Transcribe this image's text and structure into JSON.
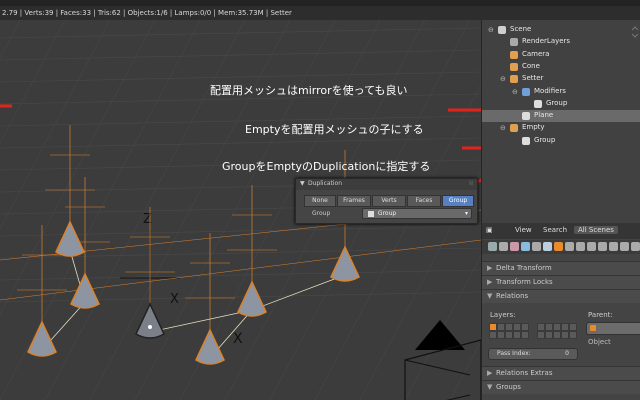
{
  "status": {
    "text": "2.79 | Verts:39 | Faces:33 | Tris:62 | Objects:1/6 | Lamps:0/0 | Mem:35.73M | Setter"
  },
  "outliner": {
    "items": [
      {
        "label": "Scene",
        "icon": "scene-icon",
        "color": "#cfcfcf"
      },
      {
        "label": "RenderLayers",
        "icon": "render-layers-icon",
        "color": "#a9a9a9"
      },
      {
        "label": "Camera",
        "icon": "camera-icon",
        "color": "#e0a050"
      },
      {
        "label": "Cone",
        "icon": "cone-icon",
        "color": "#e0a050"
      },
      {
        "label": "Setter",
        "icon": "object-icon",
        "color": "#e0a050"
      },
      {
        "label": "Modifiers",
        "icon": "wrench-icon",
        "color": "#6fa0d8"
      },
      {
        "label": "Group",
        "icon": "group-icon",
        "color": "#dddddd"
      },
      {
        "label": "Plane",
        "icon": "mesh-icon",
        "color": "#dddddd"
      },
      {
        "label": "Empty",
        "icon": "empty-icon",
        "color": "#e0a050"
      },
      {
        "label": "Group",
        "icon": "group-icon",
        "color": "#dddddd"
      }
    ]
  },
  "annotations": [
    {
      "text": "配置用メッシュはmirrorを使っても良い"
    },
    {
      "text": "Emptyを配置用メッシュの子にする"
    },
    {
      "text": "GroupをEmptyのDuplicationに指定する"
    }
  ],
  "duplication": {
    "title": "Duplication",
    "buttons": [
      "None",
      "Frames",
      "Verts",
      "Faces",
      "Group"
    ],
    "active": "Group",
    "group_label": "Group",
    "group_value": "Group"
  },
  "properties": {
    "tabs": [
      "View",
      "Search",
      "All Scenes"
    ],
    "panels": [
      "Delta Transform",
      "Transform Locks",
      "Relations",
      "Relations Extras",
      "Groups"
    ],
    "layers_label": "Layers:",
    "parent_label": "Parent:",
    "parent_type": "Object",
    "pass_index_label": "Pass Index:",
    "pass_index_value": "0"
  },
  "colors": {
    "accent": "#5680c2",
    "selection_orange": "#e98a2c",
    "arrow_red": "#e0241a"
  }
}
